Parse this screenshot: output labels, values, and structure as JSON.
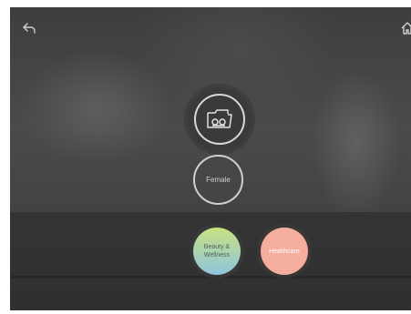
{
  "icons": {
    "back": "back-arrow-icon",
    "home": "home-icon",
    "folder": "folder-icon"
  },
  "buttons": {
    "gender_label": "Female",
    "categories": [
      {
        "label_line1": "Beauty &",
        "label_line2": "Wellness",
        "color_top": "#c8e17e",
        "color_bottom": "#8ec5de"
      },
      {
        "label": "Healthcare",
        "color": "#f5ad9c"
      }
    ]
  }
}
